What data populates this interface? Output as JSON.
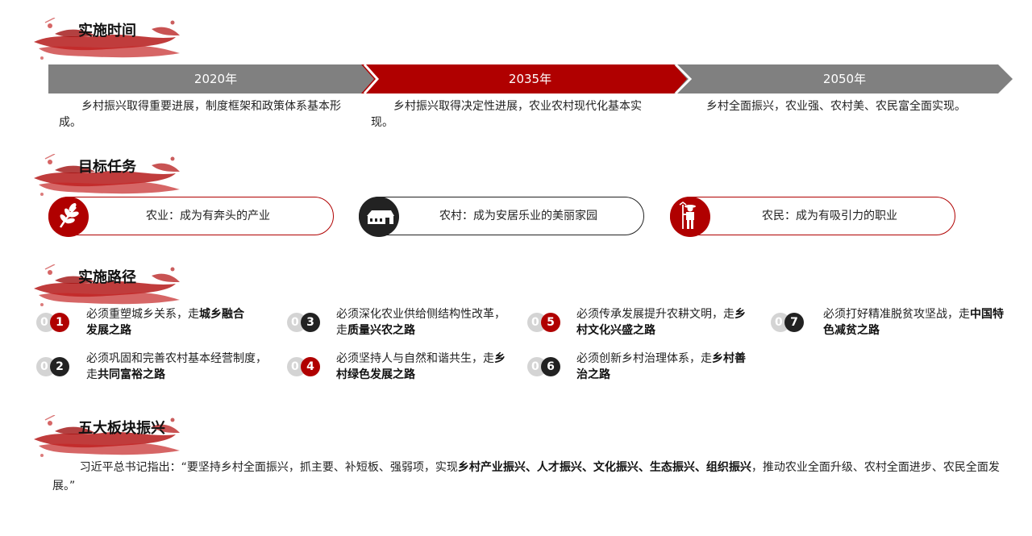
{
  "sections": {
    "time": "实施时间",
    "goals": "目标任务",
    "paths": "实施路径",
    "five": "五大板块振兴"
  },
  "timeline": [
    {
      "year": "2020年",
      "text": "乡村振兴取得重要进展，制度框架和政策体系基本形成。",
      "color": "#808080"
    },
    {
      "year": "2035年",
      "text": "乡村振兴取得决定性进展，农业农村现代化基本实现。",
      "color": "#b00000"
    },
    {
      "year": "2050年",
      "text": "乡村全面振兴，农业强、农村美、农民富全面实现。",
      "color": "#808080"
    }
  ],
  "goals": [
    {
      "text": "农业：成为有奔头的产业",
      "icon": "wheat-icon",
      "color": "#b00000"
    },
    {
      "text": "农村：成为安居乐业的美丽家园",
      "icon": "house-icon",
      "color": "#222222"
    },
    {
      "text": "农民：成为有吸引力的职业",
      "icon": "farmer-icon",
      "color": "#b00000"
    }
  ],
  "paths": [
    {
      "zero": "0",
      "num": "1",
      "pre": "必须重塑城乡关系，走",
      "bold": "城乡融合发展之路",
      "color": "#b00000"
    },
    {
      "zero": "0",
      "num": "2",
      "pre": "必须巩固和完善农村基本经营制度，走",
      "bold": "共同富裕之路",
      "color": "#222222"
    },
    {
      "zero": "0",
      "num": "3",
      "pre": "必须深化农业供给侧结构性改革，走",
      "bold": "质量兴农之路",
      "color": "#222222"
    },
    {
      "zero": "0",
      "num": "4",
      "pre": "必须坚持人与自然和谐共生，走",
      "bold": "乡村绿色发展之路",
      "color": "#b00000"
    },
    {
      "zero": "0",
      "num": "5",
      "pre": "必须传承发展提升农耕文明，走",
      "bold": "乡村文化兴盛之路",
      "color": "#b00000"
    },
    {
      "zero": "0",
      "num": "6",
      "pre": "必须创新乡村治理体系，走",
      "bold": "乡村善治之路",
      "color": "#222222"
    },
    {
      "zero": "0",
      "num": "7",
      "pre": "必须打好精准脱贫攻坚战，走",
      "bold": "中国特色减贫之路",
      "color": "#222222"
    }
  ],
  "quote": {
    "pre": "习近平总书记指出：“要坚持乡村全面振兴，抓主要、补短板、强弱项，实现",
    "bold": "乡村产业振兴、人才振兴、文化振兴、生态振兴、组织振兴",
    "post": "，推动农业全面升级、农村全面进步、农民全面发展。”"
  }
}
